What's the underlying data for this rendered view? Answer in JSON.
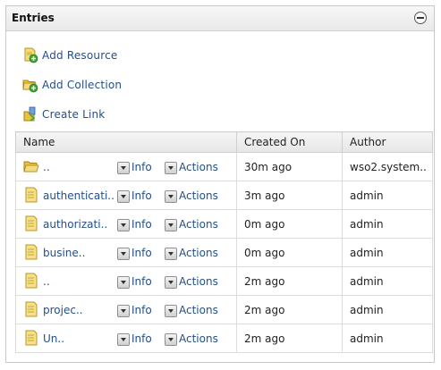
{
  "panel": {
    "title": "Entries",
    "collapse_icon": "collapse-minus-icon"
  },
  "actions": [
    {
      "label": "Add  Resource",
      "icon": "add-resource-icon"
    },
    {
      "label": "Add  Collection",
      "icon": "add-collection-icon"
    },
    {
      "label": "Create  Link",
      "icon": "create-link-icon"
    }
  ],
  "table": {
    "headers": [
      "Name",
      "Created  On",
      "Author"
    ],
    "info_label": "Info",
    "actions_label": "Actions",
    "rows": [
      {
        "icon": "folder-open-icon",
        "name": "..",
        "created": "30m  ago",
        "author": "wso2.system.."
      },
      {
        "icon": "document-icon",
        "name": "authenticati..",
        "created": "3m  ago",
        "author": "admin"
      },
      {
        "icon": "document-icon",
        "name": "authorizati..",
        "created": "0m  ago",
        "author": "admin"
      },
      {
        "icon": "document-icon",
        "name": "busine..",
        "created": "0m  ago",
        "author": "admin"
      },
      {
        "icon": "document-icon",
        "name": "..",
        "created": "2m  ago",
        "author": "admin"
      },
      {
        "icon": "document-icon",
        "name": "projec..",
        "created": "2m  ago",
        "author": "admin"
      },
      {
        "icon": "document-icon",
        "name": "Un..",
        "created": "2m  ago",
        "author": "admin"
      }
    ]
  },
  "colors": {
    "link": "#244e8a",
    "header_bg": "#ececec",
    "border": "#cfcfcf",
    "icon_yellow": "#e8c23a",
    "icon_green": "#3fa535"
  }
}
